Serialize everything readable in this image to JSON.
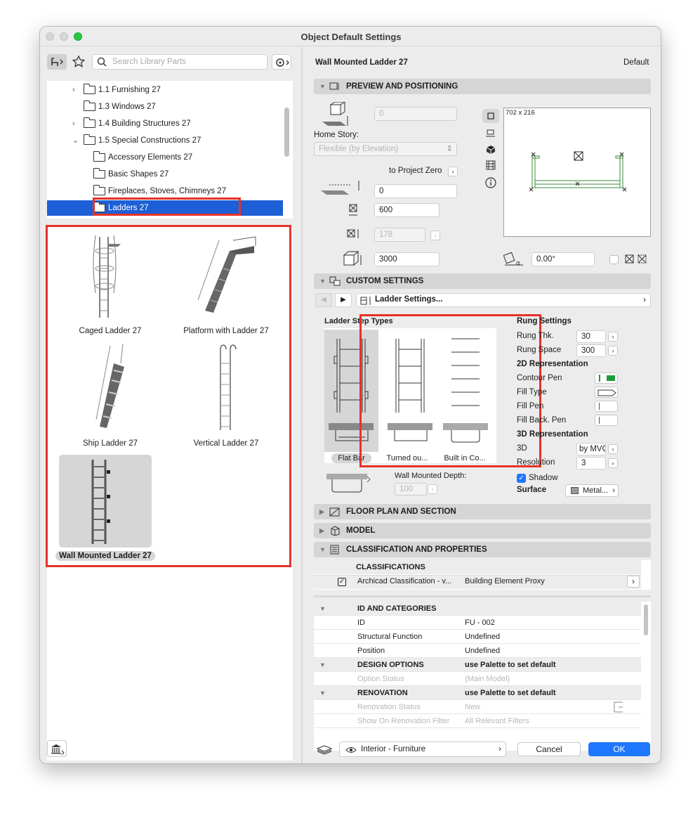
{
  "window": {
    "title": "Object Default Settings"
  },
  "left": {
    "search_placeholder": "Search Library Parts",
    "tree": [
      {
        "label": "1.1 Furnishing 27",
        "chevron": ">"
      },
      {
        "label": "1.3 Windows 27",
        "chevron": ""
      },
      {
        "label": "1.4 Building Structures 27",
        "chevron": ">"
      },
      {
        "label": "1.5 Special Constructions 27",
        "chevron": "v"
      },
      {
        "label": "Accessory Elements 27",
        "chevron": ""
      },
      {
        "label": "Basic Shapes 27",
        "chevron": ""
      },
      {
        "label": "Fireplaces, Stoves, Chimneys 27",
        "chevron": ""
      },
      {
        "label": "Ladders 27",
        "chevron": ""
      }
    ],
    "gallery": [
      {
        "label": "Caged Ladder 27"
      },
      {
        "label": "Platform with Ladder 27"
      },
      {
        "label": "Ship Ladder 27"
      },
      {
        "label": "Vertical Ladder 27"
      },
      {
        "label": "Wall Mounted Ladder 27"
      }
    ]
  },
  "header": {
    "object_name": "Wall Mounted Ladder 27",
    "default_label": "Default"
  },
  "preview": {
    "section_title": "PREVIEW AND POSITIONING",
    "elevation_value": "0",
    "home_story_label": "Home Story:",
    "home_story_value": "Flexible (by Elevation)",
    "to_project_zero": "to Project Zero",
    "project_zero_value": "0",
    "width_value": "600",
    "depth_value": "178",
    "height_value": "3000",
    "angle_value": "0.00°",
    "preview_size": "702 x 216"
  },
  "custom": {
    "section_title": "CUSTOM SETTINGS",
    "dropdown_label": "Ladder Settings...",
    "step_types_title": "Ladder Step Types",
    "step_types": [
      "Flat Bar",
      "Turned ou...",
      "Built in Co..."
    ],
    "wall_depth_label": "Wall Mounted Depth:",
    "wall_depth_value": "100",
    "rung_settings_title": "Rung Settings",
    "rung_thk_label": "Rung Thk.",
    "rung_thk_value": "30",
    "rung_space_label": "Rung Space",
    "rung_space_value": "300",
    "rep2d_title": "2D Representation",
    "contour_pen_label": "Contour Pen",
    "fill_type_label": "Fill Type",
    "fill_pen_label": "Fill Pen",
    "fill_back_pen_label": "Fill Back. Pen",
    "rep3d_title": "3D Representation",
    "threed_label": "3D",
    "threed_value": "by MVO",
    "resolution_label": "Resolution",
    "resolution_value": "3",
    "shadow_label": "Shadow",
    "surface_label": "Surface",
    "surface_value": "Metal..."
  },
  "sections": {
    "floor_plan": "FLOOR PLAN AND SECTION",
    "model": "MODEL",
    "classification": "CLASSIFICATION AND PROPERTIES"
  },
  "classifications": {
    "title": "CLASSIFICATIONS",
    "system": "Archicad Classification - v...",
    "value": "Building Element Proxy"
  },
  "properties": [
    {
      "group": true,
      "name": "ID AND CATEGORIES",
      "value": ""
    },
    {
      "group": false,
      "name": "ID",
      "value": "FU - 002",
      "dim": false
    },
    {
      "group": false,
      "name": "Structural Function",
      "value": "Undefined",
      "dim": false
    },
    {
      "group": false,
      "name": "Position",
      "value": "Undefined",
      "dim": false
    },
    {
      "group": true,
      "name": "DESIGN OPTIONS",
      "value": "use Palette to set default"
    },
    {
      "group": false,
      "name": "Option Status",
      "value": "(Main Model)",
      "dim": true
    },
    {
      "group": true,
      "name": "RENOVATION",
      "value": "use Palette to set default"
    },
    {
      "group": false,
      "name": "Renovation Status",
      "value": "New",
      "dim": true
    },
    {
      "group": false,
      "name": "Show On Renovation Filter",
      "value": "All Relevant Filters",
      "dim": true
    }
  ],
  "footer": {
    "layer_value": "Interior - Furniture",
    "cancel_label": "Cancel",
    "ok_label": "OK"
  },
  "colors": {
    "accent": "#1e78ff",
    "selection": "#1d5fd6",
    "highlight_box": "#e53228"
  }
}
